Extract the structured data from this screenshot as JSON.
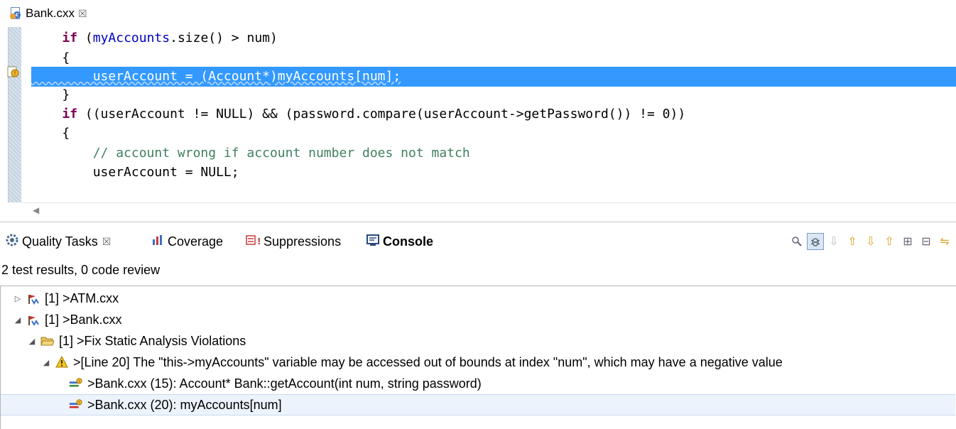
{
  "editor": {
    "tab_label": "Bank.cxx",
    "tab_close": "☒",
    "lines": [
      {
        "indent": "    ",
        "kw": "if",
        "rest": " (",
        "fld": "myAccounts",
        "rest2": ".size() > num)"
      },
      {
        "text": "    {"
      },
      {
        "text": "        userAccount = (Account*)myAccounts[num];"
      },
      {
        "text": "    }"
      },
      {
        "indent": "    ",
        "kw": "if",
        "rest": " ((userAccount != NULL) && (password.compare(userAccount->getPassword()) != 0))"
      },
      {
        "text": "    {"
      },
      {
        "comment": "        // account wrong if account number does not match"
      },
      {
        "text": "        userAccount = NULL;"
      }
    ]
  },
  "panel": {
    "tabs": [
      {
        "label": "Quality Tasks",
        "icon": "quality-tasks-icon"
      },
      {
        "label": "Coverage",
        "icon": "coverage-icon"
      },
      {
        "label": "Suppressions",
        "icon": "suppressions-icon"
      },
      {
        "label": "Console",
        "icon": "console-icon"
      }
    ],
    "tab_close": "☒",
    "summary": "2 test results, 0 code review",
    "tree": [
      {
        "label": "[1] >ATM.cxx"
      },
      {
        "label": "[1] >Bank.cxx"
      },
      {
        "label": "[1] >Fix Static Analysis Violations"
      },
      {
        "label": ">[Line 20] The \"this->myAccounts\" variable may be accessed out of bounds at index \"num\", which may have a negative value"
      },
      {
        "label": ">Bank.cxx (15): Account* Bank::getAccount(int num, string password)"
      },
      {
        "label": ">Bank.cxx (20): myAccounts[num]"
      }
    ]
  },
  "colors": {
    "selection": "#3399ff",
    "keyword": "#7f0055",
    "field": "#0000c0",
    "comment": "#3f7f5f"
  }
}
